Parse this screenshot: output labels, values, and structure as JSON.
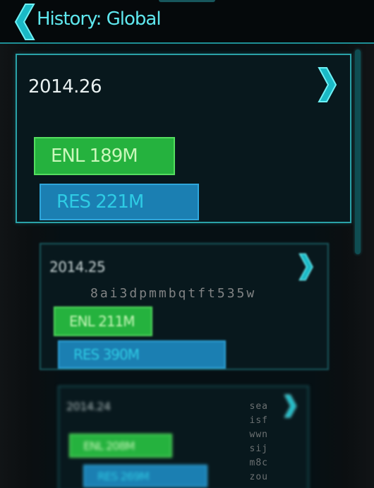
{
  "header": {
    "title": "History: Global",
    "back_icon": "chevron-left-icon"
  },
  "entries": [
    {
      "date": "2014.26",
      "enl": "ENL 189M",
      "res": "RES 221M"
    },
    {
      "date": "2014.25",
      "enl": "ENL 211M",
      "res": "RES 390M"
    },
    {
      "date": "2014.24",
      "enl": "ENL 208M",
      "res": "RES 269M"
    }
  ],
  "overlay": {
    "line": "8ai3dpmmbqtft535w",
    "column": [
      "sea",
      "isf",
      "wwn",
      "sij",
      "m8c",
      "zou"
    ]
  },
  "colors": {
    "accent": "#5fe8ef",
    "enlightened": "#25b23e",
    "resistance": "#1b7fb2",
    "card_border": "#2aa2a8"
  },
  "icons": {
    "entry_open": "chevron-right-icon"
  }
}
